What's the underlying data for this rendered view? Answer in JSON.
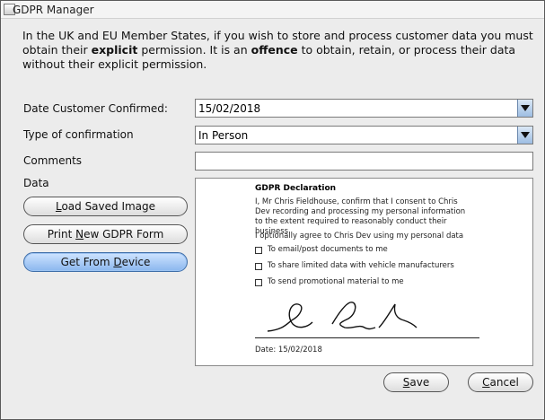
{
  "window": {
    "title": "GDPR Manager"
  },
  "intro": {
    "p1": "In the UK and EU Member States, if you wish to store and process customer data you must obtain their ",
    "b1": "explicit",
    "p2": " permission.  It is an ",
    "b2": "offence",
    "p3": " to obtain, retain, or process their data without their explicit permission."
  },
  "form": {
    "date_label": "Date Customer Confirmed:",
    "date_value": "15/02/2018",
    "type_label": "Type of confirmation",
    "type_value": "In Person",
    "comments_label": "Comments",
    "comments_value": "",
    "data_label": "Data"
  },
  "buttons": {
    "load_hotkey": "L",
    "load_rest": "oad Saved Image",
    "print_pre": "Print ",
    "print_hotkey": "N",
    "print_rest": "ew GDPR Form",
    "device_pre": "Get From ",
    "device_hotkey": "D",
    "device_rest": "evice",
    "save_hotkey": "S",
    "save_rest": "ave",
    "cancel_hotkey": "C",
    "cancel_rest": "ancel"
  },
  "declaration": {
    "title": "GDPR Declaration",
    "body": "I, Mr Chris Fieldhouse, confirm that I consent to Chris Dev recording and processing my personal information to the extent required to reasonably conduct their business",
    "optional": "I optionally agree to Chris Dev using my personal data",
    "options": [
      "To email/post documents to me",
      "To share limited data with vehicle manufacturers",
      "To send promotional material to me"
    ],
    "date": "Date: 15/02/2018"
  },
  "icons": {
    "dropdown": "chevron-down-icon",
    "window_controls": "close-icon"
  },
  "colors": {
    "accent_button": "#8ab6ee",
    "dropdown_button": "#9dbde3"
  }
}
